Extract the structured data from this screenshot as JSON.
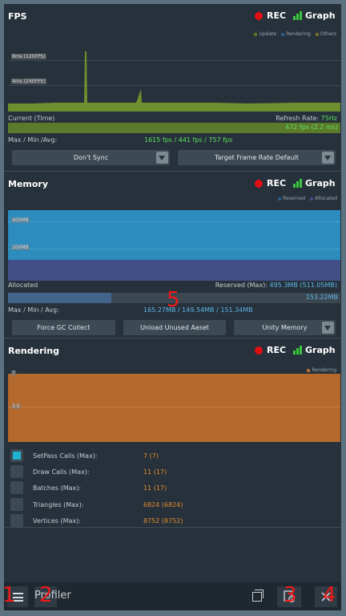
{
  "fps": {
    "title": "FPS",
    "rec_label": "REC",
    "graph_label": "Graph",
    "legend": [
      {
        "label": "Update",
        "color": "#5a6f2a"
      },
      {
        "label": "Rendering",
        "color": "#2b5e88"
      },
      {
        "label": "Others",
        "color": "#6f6a2e"
      }
    ],
    "axis_8ms": "8ms (120FPS)",
    "axis_4ms": "4ms (240FPS)",
    "current_label": "Current (Time)",
    "refresh_label": "Refresh Rate: ",
    "refresh_value": "75Hz",
    "current_value": "472 fps (2.2 ms)",
    "current_fraction": 1.0,
    "maxminavg_label": "Max / Min /Avg:",
    "maxminavg_value": "1615 fps / 441 fps / 757 fps",
    "sync_select": "Don't Sync",
    "target_select": "Target Frame Rate Default",
    "colors": {
      "graph": "#6e8f2d",
      "bar": "#5c7a2b",
      "value": "#5ee15e"
    }
  },
  "memory": {
    "title": "Memory",
    "rec_label": "REC",
    "graph_label": "Graph",
    "legend": [
      {
        "label": "Reserved",
        "color": "#2b5e88"
      },
      {
        "label": "Allocated",
        "color": "#444f82"
      }
    ],
    "axis_400": "400MB",
    "axis_200": "200MB",
    "allocated_label": "Allocated",
    "reserved_label": "Reserved (Max): ",
    "reserved_value": "495.3MB (511.05MB)",
    "allocated_value": "153.22MB",
    "allocated_fraction": 0.31,
    "maxminavg_label": "Max / Min / Avg:",
    "maxminavg_value": "165.27MB / 149.54MB / 151.34MB",
    "force_gc": "Force GC Collect",
    "unload_assets": "Unload Unused Aaset",
    "unity_memory_select": "Unity Memory",
    "colors": {
      "reserved": "#2b8cbd",
      "allocated": "#424f87"
    }
  },
  "rendering": {
    "title": "Rendering",
    "rec_label": "REC",
    "graph_label": "Graph",
    "legend": [
      {
        "label": "Rendering",
        "color": "#b5692c"
      }
    ],
    "axis_7": "7",
    "axis_35": "3.5",
    "stats": [
      {
        "label": "SetPass Calls (Max):",
        "value": "7 (7)",
        "checked": true
      },
      {
        "label": "Draw Calls (Max):",
        "value": "11 (17)",
        "checked": false
      },
      {
        "label": "Batches (Max):",
        "value": "11 (17)",
        "checked": false
      },
      {
        "label": "Triangles (Max):",
        "value": "6824 (6824)",
        "checked": false
      },
      {
        "label": "Vertices (Max):",
        "value": "8752 (8752)",
        "checked": false
      }
    ],
    "colors": {
      "graph": "#b5692c"
    }
  },
  "toolbar": {
    "title": "Profiler",
    "menu_icon": "hamburger-icon",
    "window_icon": "window-icon",
    "settings_icon": "gear-page-icon",
    "close_icon": "close-icon"
  },
  "markers": [
    "1",
    "2",
    "3",
    "4",
    "5"
  ]
}
